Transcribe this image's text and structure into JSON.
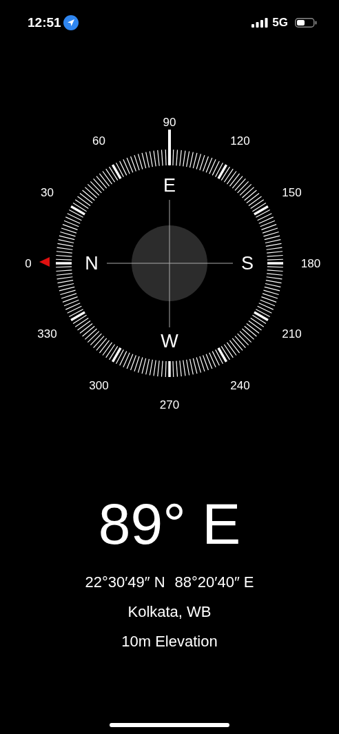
{
  "status_bar": {
    "time": "12:51",
    "network": "5G"
  },
  "compass": {
    "degree_labels": [
      {
        "text": "0"
      },
      {
        "text": "30"
      },
      {
        "text": "60"
      },
      {
        "text": "90"
      },
      {
        "text": "120"
      },
      {
        "text": "150"
      },
      {
        "text": "180"
      },
      {
        "text": "210"
      },
      {
        "text": "240"
      },
      {
        "text": "270"
      },
      {
        "text": "300"
      },
      {
        "text": "330"
      }
    ],
    "cardinals": [
      {
        "text": "N"
      },
      {
        "text": "E"
      },
      {
        "text": "S"
      },
      {
        "text": "W"
      }
    ]
  },
  "heading": "89° E",
  "coordinates": [
    "22°30′49″ N",
    "88°20′40″ E"
  ],
  "location": "Kolkata, WB",
  "elevation": "10m Elevation"
}
